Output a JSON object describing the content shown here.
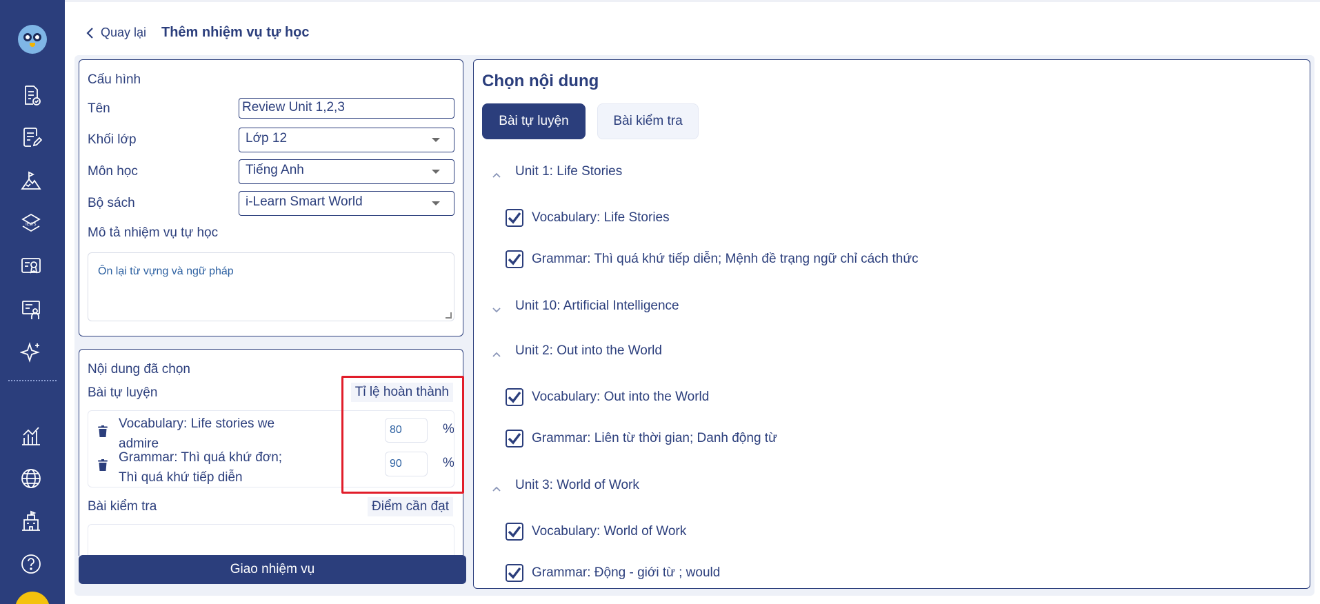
{
  "header": {
    "back_label": "Quay lại",
    "title": "Thêm nhiệm vụ tự học"
  },
  "config": {
    "heading": "Cấu hình",
    "name_label": "Tên",
    "name_value": "Review Unit 1,2,3",
    "grade_label": "Khối lớp",
    "grade_value": "Lớp 12",
    "subject_label": "Môn học",
    "subject_value": "Tiếng Anh",
    "book_label": "Bộ sách",
    "book_value": "i-Learn Smart World",
    "description_label": "Mô tả nhiệm vụ tự học",
    "description_value": "Ôn lại từ vựng và ngữ pháp"
  },
  "selected": {
    "heading": "Nội dung đã chọn",
    "practice_label": "Bài tự luyện",
    "rate_header": "Tỉ lệ hoàn thành",
    "items": [
      {
        "name": "Vocabulary: Life stories we admire",
        "value": "80",
        "unit": "%"
      },
      {
        "name": "Grammar: Thì quá khứ đơn; Thì quá khứ tiếp diễn",
        "value": "90",
        "unit": "%"
      }
    ],
    "test_label": "Bài kiểm tra",
    "score_header": "Điểm cần đạt"
  },
  "submit_label": "Giao nhiệm vụ",
  "content": {
    "heading": "Chọn nội dung",
    "tabs": [
      "Bài tự luyện",
      "Bài kiểm tra"
    ],
    "units": [
      {
        "title": "Unit 1: Life Stories",
        "expanded": true,
        "lessons": [
          "Vocabulary: Life Stories",
          "Grammar: Thì quá khứ tiếp diễn; Mệnh đề trạng ngữ chỉ cách thức"
        ]
      },
      {
        "title": "Unit 10: Artificial Intelligence",
        "expanded": false,
        "lessons": []
      },
      {
        "title": "Unit 2: Out into the World",
        "expanded": true,
        "lessons": [
          "Vocabulary: Out into the World",
          "Grammar: Liên từ thời gian; Danh động từ"
        ]
      },
      {
        "title": "Unit 3: World of Work",
        "expanded": true,
        "lessons": [
          "Vocabulary: World of Work",
          "Grammar: Động - giới từ ; would"
        ]
      }
    ]
  },
  "nav_icons": [
    "assignment-check-icon",
    "assignment-edit-icon",
    "mountain-flag-icon",
    "ielts-icon",
    "certificate-icon",
    "teacher-board-icon",
    "sparkle-icon",
    "chart-icon",
    "globe-icon",
    "school-icon",
    "help-icon"
  ],
  "colors": {
    "primary": "#2b3e7c",
    "highlight": "#e11d2a"
  }
}
